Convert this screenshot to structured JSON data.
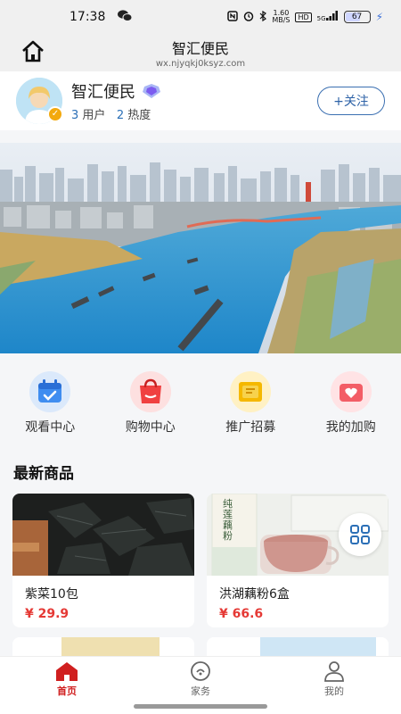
{
  "status_bar": {
    "time": "17:38",
    "net_speed_value": "1.60",
    "net_speed_unit": "MB/S",
    "hd": "HD",
    "signal": "5G",
    "battery": "67"
  },
  "header": {
    "title": "智汇便民",
    "domain": "wx.njyqkj0ksyz.com"
  },
  "profile": {
    "name": "智汇便民",
    "users_count": "3",
    "users_label": "用户",
    "heat_count": "2",
    "heat_label": "热度",
    "follow_label": "+关注"
  },
  "quick_menu": [
    {
      "label": "观看中心",
      "icon": "calendar-icon",
      "color": "#3f8df0"
    },
    {
      "label": "购物中心",
      "icon": "shopping-bag-icon",
      "color": "#f04040"
    },
    {
      "label": "推广招募",
      "icon": "promotion-icon",
      "color": "#f5b800"
    },
    {
      "label": "我的加购",
      "icon": "heart-box-icon",
      "color": "#f35d66"
    }
  ],
  "section": {
    "latest_products": "最新商品"
  },
  "products": [
    {
      "name": "紫菜10包",
      "price": "¥ 29.9",
      "package_text": ""
    },
    {
      "name": "洪湖藕粉6盒",
      "price": "¥ 66.6",
      "package_text": "纯莲藕粉"
    }
  ],
  "tabs": [
    {
      "label": "首页",
      "icon": "home-icon",
      "active": true
    },
    {
      "label": "家务",
      "icon": "housework-icon",
      "active": false
    },
    {
      "label": "我的",
      "icon": "profile-icon",
      "active": false
    }
  ],
  "colors": {
    "accent": "#d01f1f",
    "price": "#e53935",
    "follow": "#2d62a7"
  }
}
